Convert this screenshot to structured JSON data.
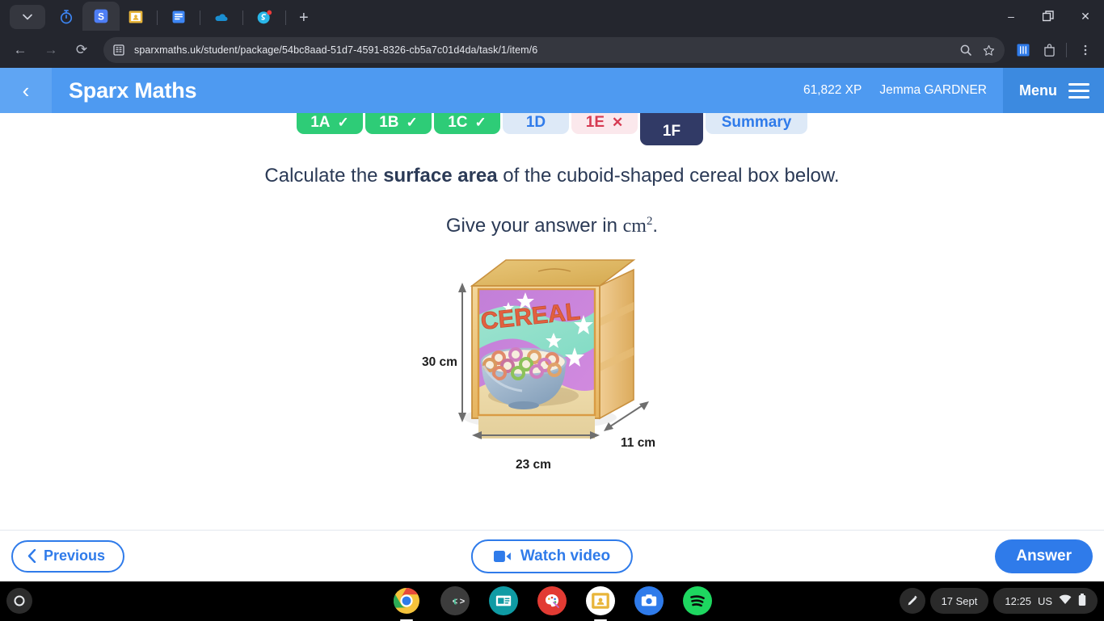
{
  "browser": {
    "tabs": [
      {
        "name": "tab-dropdown",
        "icon": "chevron-down-icon"
      },
      {
        "name": "tab-timer",
        "icon": "timer-icon"
      },
      {
        "name": "tab-sparx",
        "icon": "sparx-s-icon",
        "active": true
      },
      {
        "name": "tab-classroom",
        "icon": "google-classroom-icon"
      },
      {
        "name": "tab-docs",
        "icon": "document-icon"
      },
      {
        "name": "tab-onedrive",
        "icon": "onedrive-cloud-icon"
      },
      {
        "name": "tab-sparx-reader",
        "icon": "sparx-reader-icon",
        "badge": true
      }
    ],
    "new_tab_label": "+",
    "window_controls": {
      "minimize": "–",
      "restore": "❐",
      "close": "✕"
    },
    "nav": {
      "back": "←",
      "forward": "→",
      "reload": "⟳"
    },
    "url": "sparxmaths.uk/student/package/54bc8aad-51d7-4591-8326-cb5a7c01d4da/task/1/item/6",
    "omnibox_icons": [
      "site-info-icon",
      "zoom-icon",
      "bookmark-star-icon"
    ],
    "toolbar_icons": [
      "reading-list-icon",
      "extensions-icon",
      "kebab-menu-icon"
    ]
  },
  "app_header": {
    "back_label": "‹",
    "title": "Sparx Maths",
    "xp": "61,822 XP",
    "user": "Jemma GARDNER",
    "menu_label": "Menu"
  },
  "question_tabs": [
    {
      "label": "1A",
      "state": "done",
      "mark": "✓"
    },
    {
      "label": "1B",
      "state": "done",
      "mark": "✓"
    },
    {
      "label": "1C",
      "state": "done",
      "mark": "✓"
    },
    {
      "label": "1D",
      "state": "todo",
      "mark": ""
    },
    {
      "label": "1E",
      "state": "wrong",
      "mark": "✕"
    },
    {
      "label": "1F",
      "state": "current",
      "mark": ""
    },
    {
      "label": "Summary",
      "state": "summary",
      "mark": ""
    }
  ],
  "question": {
    "line1_a": "Calculate the ",
    "line1_bold": "surface area",
    "line1_b": " of the cuboid-shaped cereal box below.",
    "line2_a": "Give your answer in ",
    "line2_unit": "cm",
    "line2_exp": "2",
    "line2_b": "."
  },
  "diagram": {
    "alt": "cuboid cereal box",
    "box_front_text": "CEREAL",
    "height_label": "30 cm",
    "width_label": "23 cm",
    "depth_label": "11 cm"
  },
  "actions": {
    "previous": "Previous",
    "watch_video": "Watch video",
    "answer": "Answer"
  },
  "shelf": {
    "launcher_icon": "launcher-circle-icon",
    "apps": [
      {
        "name": "chrome-icon",
        "running": true
      },
      {
        "name": "tutor-t-icon",
        "running": false
      },
      {
        "name": "news-icon",
        "running": false
      },
      {
        "name": "paint-palette-icon",
        "running": false
      },
      {
        "name": "google-classroom-icon",
        "running": true
      },
      {
        "name": "camera-icon",
        "running": false
      },
      {
        "name": "spotify-icon",
        "running": false
      }
    ],
    "pen_icon": "stylus-pen-icon",
    "date": "17 Sept",
    "time": "12:25",
    "locale": "US",
    "status_icons": [
      "wifi-icon",
      "battery-icon"
    ]
  },
  "colors": {
    "sparx_blue": "#4e9af1",
    "accent_blue": "#2f7bea",
    "done_green": "#2ecc77",
    "wrong_red": "#d63b53",
    "current_navy": "#313a66"
  }
}
